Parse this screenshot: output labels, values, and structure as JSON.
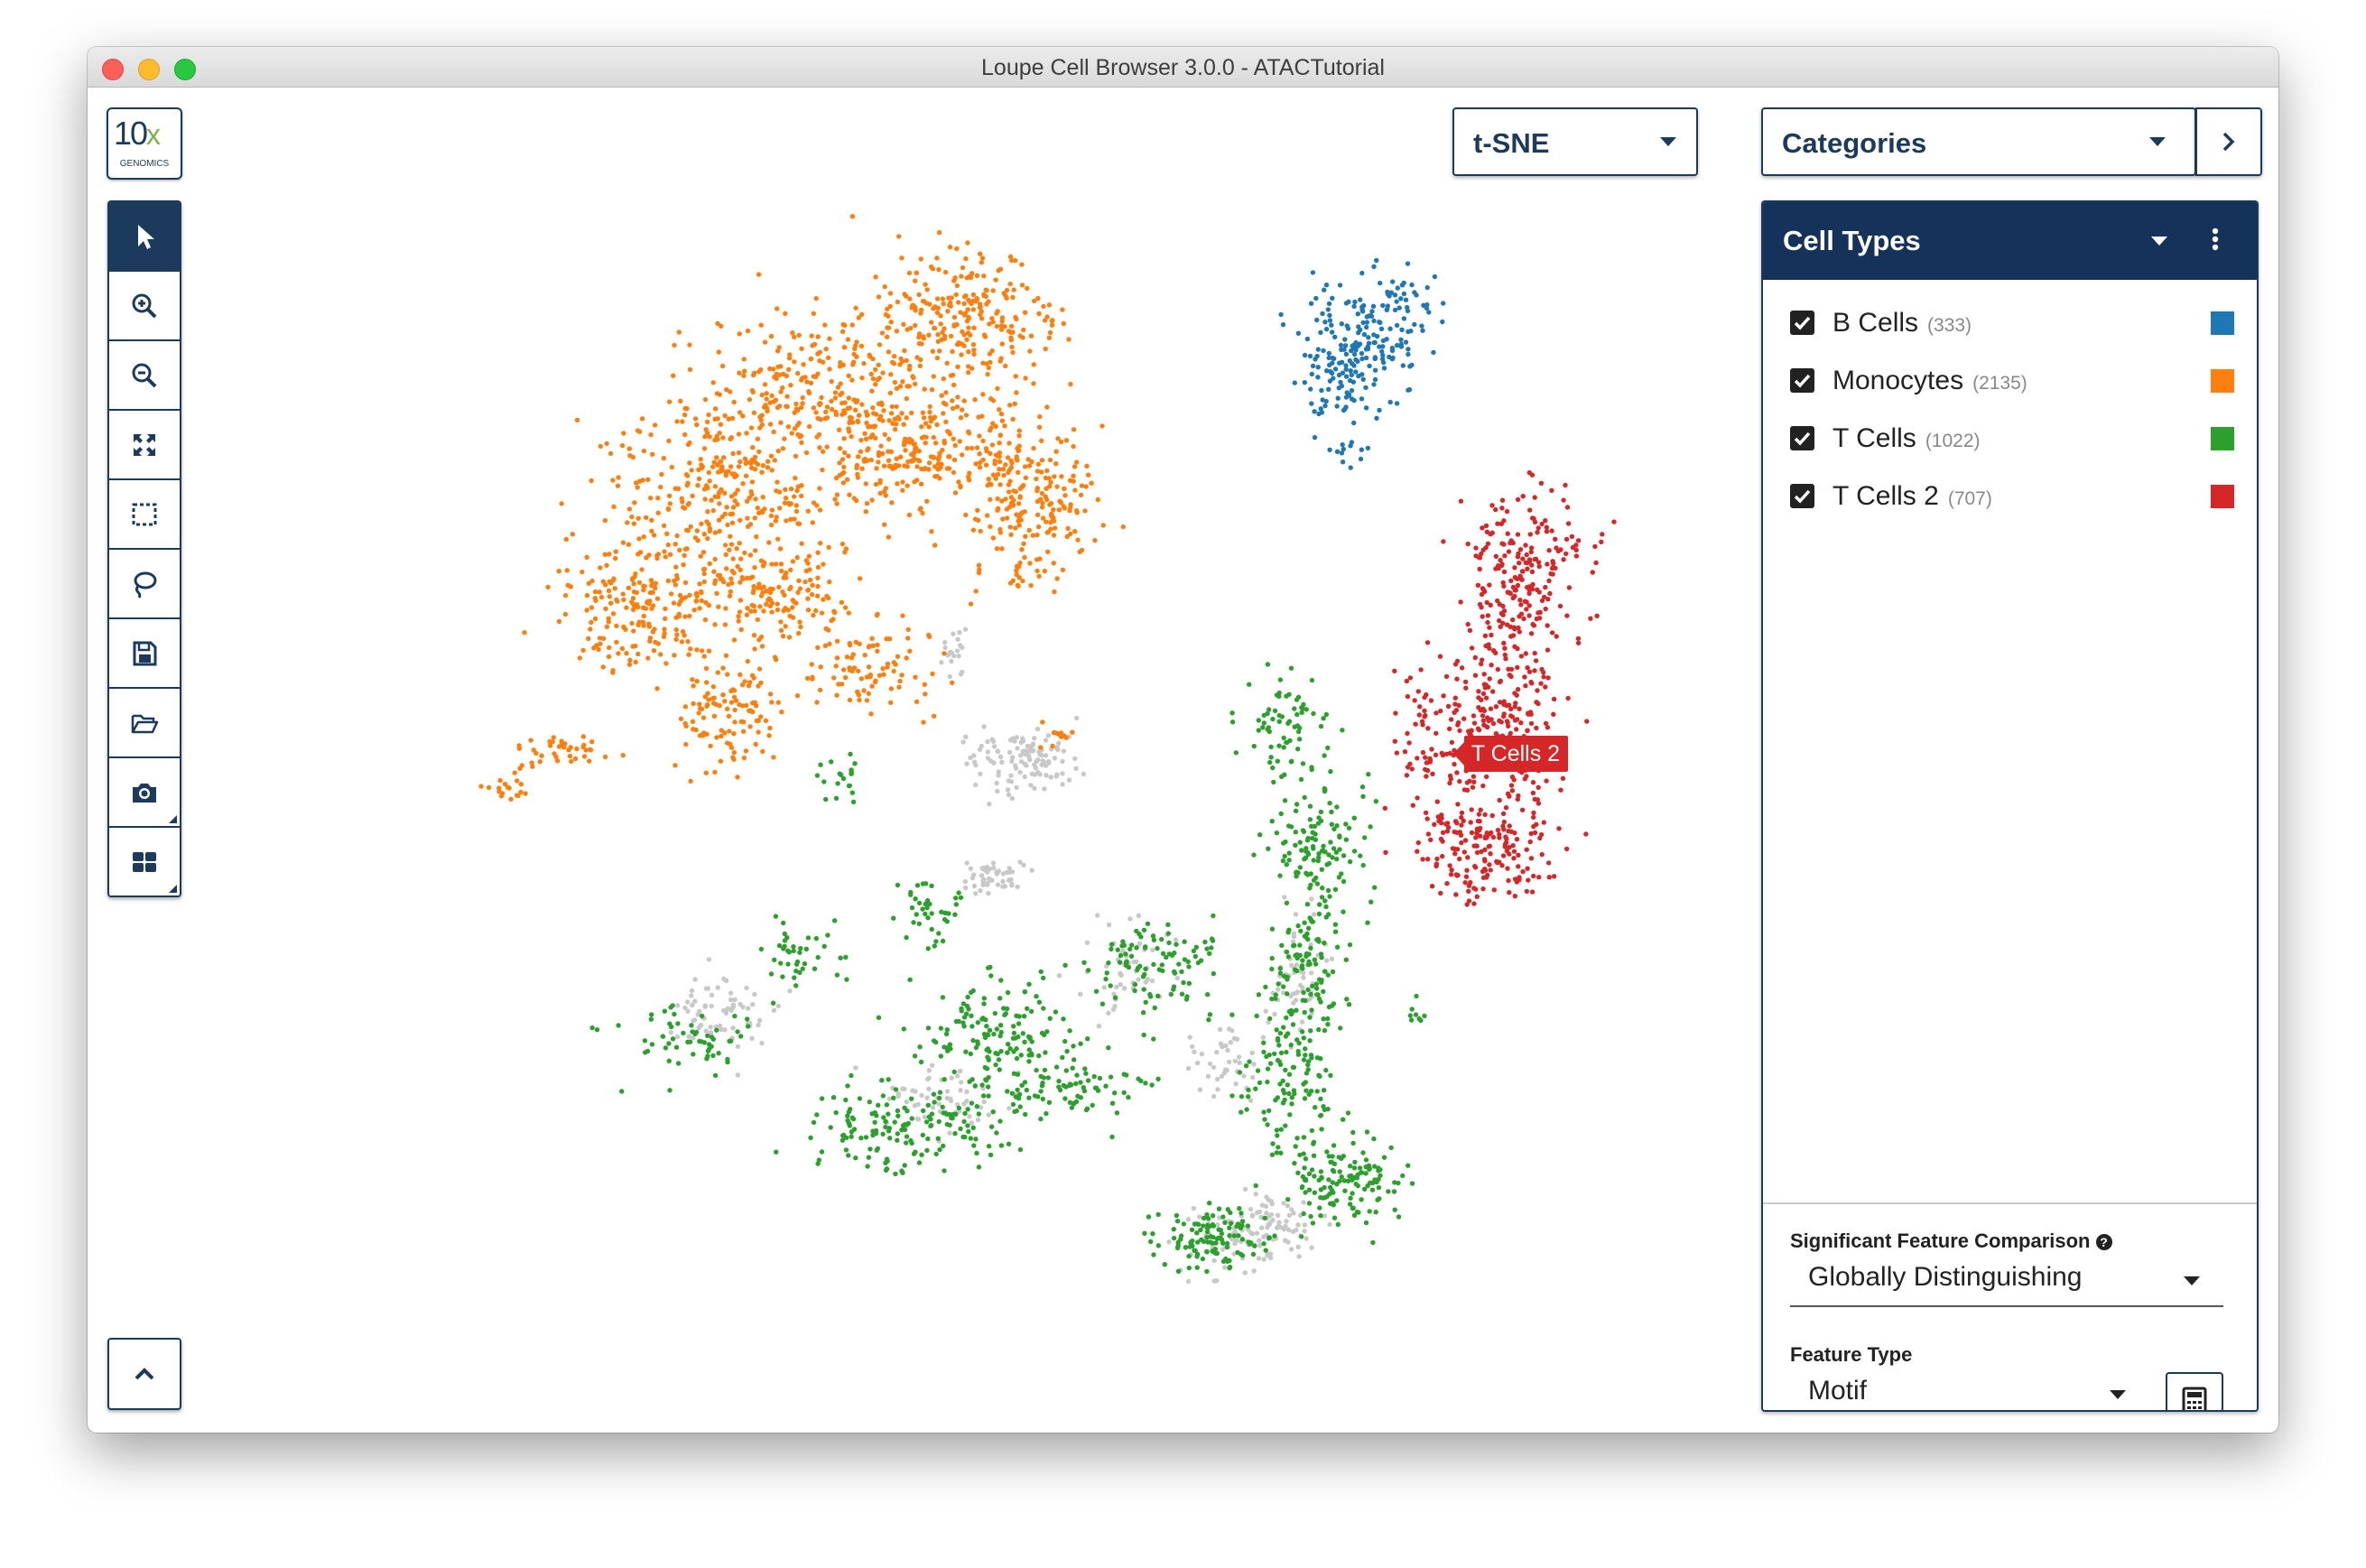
{
  "window": {
    "title": "Loupe Cell Browser 3.0.0 - ATACTutorial"
  },
  "logo": {
    "main": "10",
    "x": "x",
    "sub": "GENOMICS"
  },
  "toolbar": {
    "tools": [
      {
        "name": "select-tool",
        "icon": "cursor-icon",
        "active": true
      },
      {
        "name": "zoom-in-tool",
        "icon": "zoom-in-icon"
      },
      {
        "name": "zoom-out-tool",
        "icon": "zoom-out-icon"
      },
      {
        "name": "fit-view-tool",
        "icon": "expand-arrows-icon"
      },
      {
        "name": "box-select-tool",
        "icon": "dashed-rectangle-icon"
      },
      {
        "name": "lasso-tool",
        "icon": "lasso-icon"
      },
      {
        "name": "save-tool",
        "icon": "floppy-disk-icon"
      },
      {
        "name": "open-tool",
        "icon": "folder-open-icon"
      },
      {
        "name": "screenshot-tool",
        "icon": "camera-icon"
      },
      {
        "name": "layout-tool",
        "icon": "grid-icon"
      }
    ]
  },
  "header": {
    "projection": "t-SNE",
    "mode": "Categories"
  },
  "panel": {
    "title": "Cell Types",
    "items": [
      {
        "label": "B Cells",
        "count": "(333)",
        "color": "#1f77b4",
        "checked": true
      },
      {
        "label": "Monocytes",
        "count": "(2135)",
        "color": "#ff7f0e",
        "checked": true
      },
      {
        "label": "T Cells",
        "count": "(1022)",
        "color": "#2ca02c",
        "checked": true
      },
      {
        "label": "T Cells 2",
        "count": "(707)",
        "color": "#d62728",
        "checked": true
      }
    ],
    "comparison_label": "Significant Feature Comparison",
    "comparison_value": "Globally Distinguishing",
    "feature_type_label": "Feature Type",
    "feature_type_value": "Motif"
  },
  "plot": {
    "tooltip": "T Cells 2",
    "unassigned_color": "#c8c8c8"
  },
  "chart_data": {
    "type": "scatter",
    "title": "",
    "xlabel": "",
    "ylabel": "",
    "grid": false,
    "legend": "right panel",
    "series": [
      {
        "name": "B Cells",
        "count": 333,
        "color": "#1f77b4"
      },
      {
        "name": "Monocytes",
        "count": 2135,
        "color": "#ff7f0e"
      },
      {
        "name": "T Cells",
        "count": 1022,
        "color": "#2ca02c"
      },
      {
        "name": "T Cells 2",
        "count": 707,
        "color": "#d62728"
      }
    ]
  }
}
